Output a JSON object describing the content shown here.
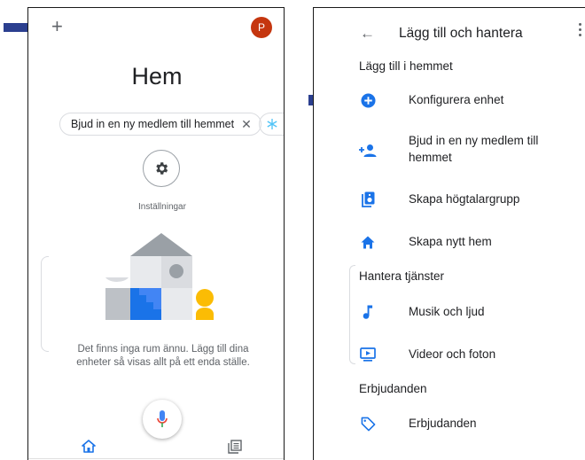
{
  "left_screen": {
    "add_icon": "+",
    "avatar_letter": "P",
    "title": "Hem",
    "invite_chip": "Bjud in en ny medlem till hemmet",
    "chip_close": "✕",
    "settings_label": "Inställningar",
    "empty_message_line1": "Det finns inga rum ännu. Lägg till dina",
    "empty_message_line2": "enheter så visas allt på ett enda ställe."
  },
  "right_screen": {
    "back_icon": "←",
    "title": "Lägg till och hantera",
    "section_add": "Lägg till i hemmet",
    "items_add": [
      {
        "label": "Konfigurera enhet",
        "icon": "add-circle-icon"
      },
      {
        "label_line1": "Bjud in en ny medlem till",
        "label_line2": "hemmet",
        "icon": "person-add-icon"
      },
      {
        "label": "Skapa högtalargrupp",
        "icon": "speaker-group-icon"
      },
      {
        "label": "Skapa nytt hem",
        "icon": "home-icon"
      }
    ],
    "section_manage": "Hantera tjänster",
    "items_manage": [
      {
        "label": "Musik och ljud",
        "icon": "music-note-icon"
      },
      {
        "label": "Videor och foton",
        "icon": "video-icon"
      }
    ],
    "section_offers": "Erbjudanden",
    "items_offers": [
      {
        "label": "Erbjudanden",
        "icon": "tag-icon"
      }
    ]
  },
  "colors": {
    "accent_blue": "#1a73e8",
    "annotation_arrow": "#2b3f8f",
    "avatar": "#c5360f"
  }
}
